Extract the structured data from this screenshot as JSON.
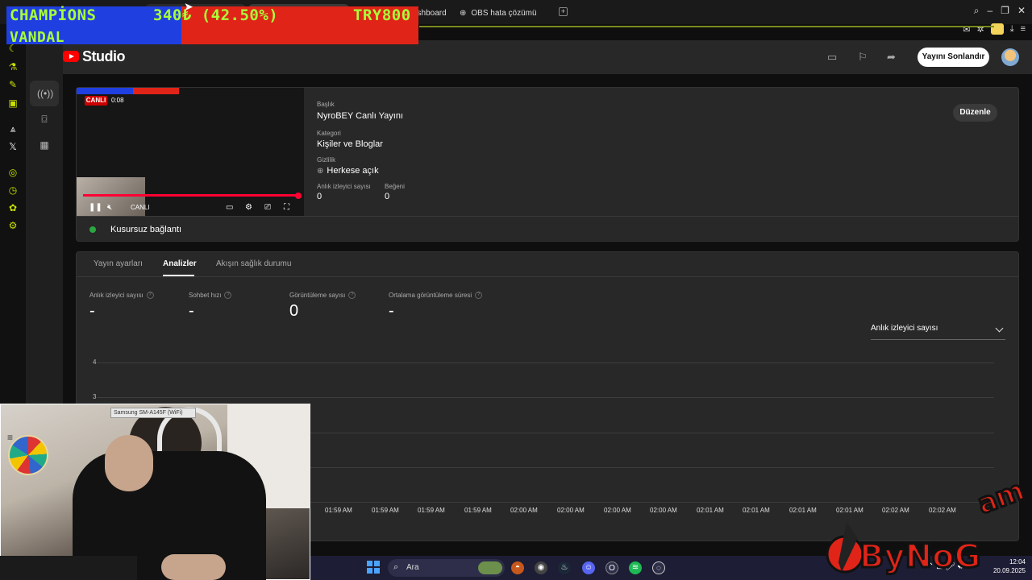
{
  "browser": {
    "tabs": [
      {
        "label": "ashboard"
      },
      {
        "label": "OBS hata çözümü"
      }
    ]
  },
  "overlay": {
    "team1": "CHAMPİONS",
    "team2": "VANDAL",
    "amount": "340₺ (42.50%)",
    "goal": "TRY800",
    "progress_fraction": 0.425
  },
  "header": {
    "logo_text": "Studio",
    "end_button": "Yayını Sonlandır"
  },
  "stream": {
    "preview_badge": "CANLI",
    "preview_time": "0:08",
    "preview_live_label": "CANLI",
    "title_label": "Başlık",
    "title": "NyroBEY Canlı Yayını",
    "category_label": "Kategori",
    "category": "Kişiler ve Bloglar",
    "privacy_label": "Gizlilik",
    "privacy": "Herkese açık",
    "viewers_label": "Anlık izleyici sayısı",
    "viewers": "0",
    "likes_label": "Beğeni",
    "likes": "0",
    "edit_button": "Düzenle",
    "connection": "Kusursuz bağlantı"
  },
  "analytics": {
    "tabs": [
      "Yayın ayarları",
      "Analizler",
      "Akışın sağlık durumu"
    ],
    "active_tab": "Analizler",
    "metrics": [
      {
        "label": "Anlık izleyici sayısı",
        "value": "-"
      },
      {
        "label": "Sohbet hızı",
        "value": "-"
      },
      {
        "label": "Görüntüleme sayısı",
        "value": "0"
      },
      {
        "label": "Ortalama görüntüleme süresi",
        "value": "-"
      }
    ],
    "dropdown": "Anlık izleyici sayısı"
  },
  "chart_data": {
    "type": "line",
    "y_ticks": [
      "4",
      "3"
    ],
    "x": [
      "01:59 AM",
      "01:59 AM",
      "01:59 AM",
      "01:59 AM",
      "02:00 AM",
      "02:00 AM",
      "02:00 AM",
      "02:00 AM",
      "02:01 AM",
      "02:01 AM",
      "02:01 AM",
      "02:01 AM",
      "02:02 AM",
      "02:02 AM"
    ],
    "ylim": [
      0,
      4
    ],
    "grid": true
  },
  "webcam": {
    "source_label": "Samsung SM-A145F (WiFi)"
  },
  "taskbar": {
    "search_placeholder": "Ara",
    "time": "12:04",
    "date": "20.09.2025"
  },
  "colors": {
    "overlay_blue": "#1f3fe0",
    "overlay_red": "#e02418",
    "overlay_text": "#a8ff3a",
    "live_red": "#cc0000",
    "connection_green": "#2ba640"
  }
}
